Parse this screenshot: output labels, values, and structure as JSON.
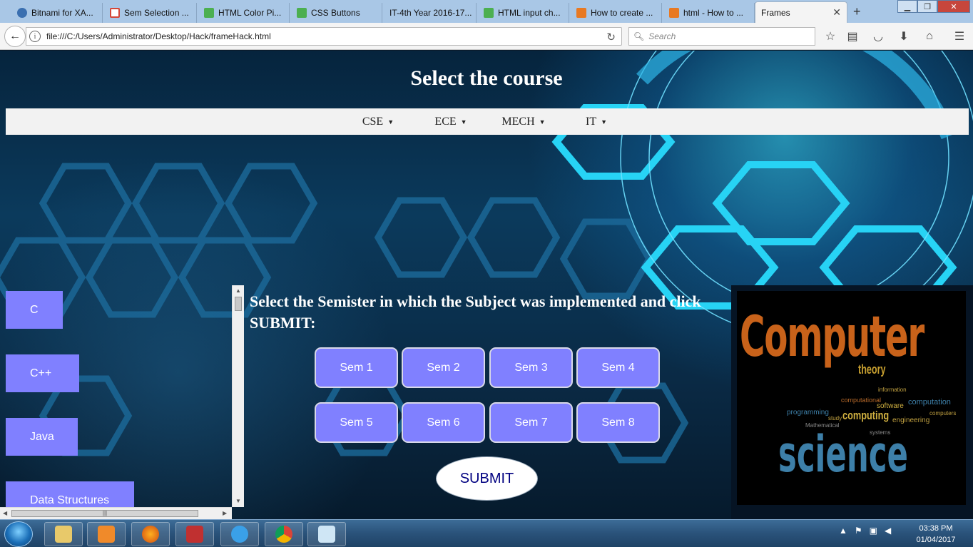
{
  "browser": {
    "tabs": [
      {
        "label": "Bitnami for XA...",
        "icon": "bitnami-icon",
        "color": "#3a6fb0"
      },
      {
        "label": "Sem Selection ...",
        "icon": "gmail-icon",
        "color": "#d44638"
      },
      {
        "label": "HTML Color Pi...",
        "icon": "w3schools-icon",
        "color": "#4caf50"
      },
      {
        "label": "CSS Buttons",
        "icon": "w3schools-icon",
        "color": "#4caf50"
      },
      {
        "label": "IT-4th Year 2016-17...",
        "icon": "blank-page-icon",
        "color": "#cccccc"
      },
      {
        "label": "HTML input ch...",
        "icon": "w3schools-icon",
        "color": "#4caf50"
      },
      {
        "label": "How to create ...",
        "icon": "stackoverflow-icon",
        "color": "#e87922"
      },
      {
        "label": "html - How to ...",
        "icon": "stackoverflow-icon",
        "color": "#e87922"
      },
      {
        "label": "Frames",
        "icon": "none",
        "color": "#ffffff"
      }
    ],
    "active_tab": "Frames",
    "url": "file:///C:/Users/Administrator/Desktop/Hack/frameHack.html",
    "search_placeholder": "Search"
  },
  "page": {
    "title": "Select the course",
    "courses": [
      "CSE",
      "ECE",
      "MECH",
      "IT"
    ],
    "subjects": [
      "C",
      "C++",
      "Java",
      "Data Structures"
    ],
    "sem_heading": "Select the Semister in which the Subject was implemented and click SUBMIT:",
    "semesters": [
      "Sem 1",
      "Sem 2",
      "Sem 3",
      "Sem 4",
      "Sem 5",
      "Sem 6",
      "Sem 7",
      "Sem 8"
    ],
    "submit_label": "SUBMIT",
    "image_words": {
      "main": "Computer",
      "second": "science",
      "theory": "theory",
      "computing": "computing",
      "software": "software",
      "engineering": "engineering",
      "computation": "computation",
      "programming": "programming",
      "computational": "computational",
      "information": "information",
      "systems": "systems",
      "mathematical": "Mathematical",
      "computers": "computers",
      "study": "study"
    },
    "colors": {
      "button": "#8080ff",
      "submit_text": "#000080",
      "menu_bg": "#f2f2f2"
    }
  },
  "taskbar": {
    "time": "03:38 PM",
    "date": "01/04/2017",
    "apps": [
      "file-explorer-icon",
      "media-player-icon",
      "firefox-icon",
      "java-app-icon",
      "internet-explorer-icon",
      "chrome-icon",
      "glass-app-icon"
    ]
  }
}
